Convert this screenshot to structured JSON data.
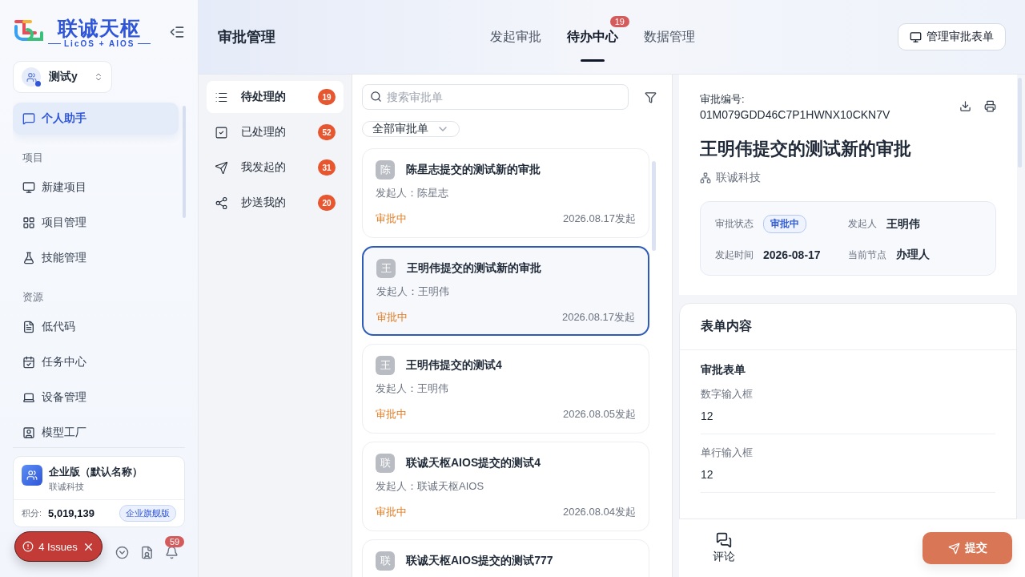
{
  "sidebar": {
    "logo": {
      "name": "联诚天枢",
      "tagline": "LicOS + AIOS"
    },
    "workspace": "测试y",
    "nav": [
      {
        "kind": "item",
        "label": "个人助手",
        "selected": true
      },
      {
        "kind": "section",
        "label": "项目"
      },
      {
        "kind": "item",
        "label": "新建项目",
        "selected": false
      },
      {
        "kind": "item",
        "label": "项目管理",
        "selected": false
      },
      {
        "kind": "item",
        "label": "技能管理",
        "selected": false
      },
      {
        "kind": "section",
        "label": "资源"
      },
      {
        "kind": "item",
        "label": "低代码",
        "selected": false
      },
      {
        "kind": "item",
        "label": "任务中心",
        "selected": false
      },
      {
        "kind": "item",
        "label": "设备管理",
        "selected": false
      },
      {
        "kind": "item",
        "label": "模型工厂",
        "selected": false
      }
    ],
    "enterprise": {
      "name": "企业版（默认名称）",
      "company": "联诚科技",
      "points_label": "积分:",
      "points": "5,019,139",
      "plan": "企业旗舰版"
    },
    "notifications_badge": "59",
    "issues": "4 Issues"
  },
  "header": {
    "title": "审批管理",
    "tabs": [
      {
        "label": "发起审批",
        "selected": false
      },
      {
        "label": "待办中心",
        "selected": true,
        "badge": "19"
      },
      {
        "label": "数据管理",
        "selected": false
      }
    ],
    "manage_button": "管理审批表单"
  },
  "subnav": [
    {
      "label": "待处理的",
      "count": "19",
      "selected": true
    },
    {
      "label": "已处理的",
      "count": "52",
      "selected": false
    },
    {
      "label": "我发起的",
      "count": "31",
      "selected": false
    },
    {
      "label": "抄送我的",
      "count": "20",
      "selected": false
    }
  ],
  "list": {
    "search_placeholder": "搜索审批单",
    "filter": "全部审批单",
    "cards": [
      {
        "avatar": "陈",
        "title": "陈星志提交的测试新的审批",
        "initiator_label": "发起人：",
        "initiator": "陈星志",
        "status": "审批中",
        "date": "2026.08.17发起",
        "selected": false
      },
      {
        "avatar": "王",
        "title": "王明伟提交的测试新的审批",
        "initiator_label": "发起人：",
        "initiator": "王明伟",
        "status": "审批中",
        "date": "2026.08.17发起",
        "selected": true
      },
      {
        "avatar": "王",
        "title": "王明伟提交的测试4",
        "initiator_label": "发起人：",
        "initiator": "王明伟",
        "status": "审批中",
        "date": "2026.08.05发起",
        "selected": false
      },
      {
        "avatar": "联",
        "title": "联诚天枢AIOS提交的测试4",
        "initiator_label": "发起人：",
        "initiator": "联诚天枢AIOS",
        "status": "审批中",
        "date": "2026.08.04发起",
        "selected": false
      },
      {
        "avatar": "联",
        "title": "联诚天枢AIOS提交的测试777",
        "selected": false
      }
    ]
  },
  "detail": {
    "number_label": "审批编号:",
    "number": "01M079GDD46C7P1HWNX10CKN7V",
    "title": "王明伟提交的测试新的审批",
    "org": "联诚科技",
    "info": [
      {
        "label": "审批状态",
        "value": "审批中",
        "kind": "badge"
      },
      {
        "label": "发起人",
        "value": "王明伟",
        "kind": "text"
      },
      {
        "label": "发起时间",
        "value": "2026-08-17",
        "kind": "text"
      },
      {
        "label": "当前节点",
        "value": "办理人",
        "kind": "text"
      }
    ],
    "form": {
      "heading": "表单内容",
      "section": "审批表单",
      "fields": [
        {
          "label": "数字输入框",
          "value": "12"
        },
        {
          "label": "单行输入框",
          "value": "12"
        }
      ]
    },
    "comment": "评论",
    "submit": "提交"
  }
}
